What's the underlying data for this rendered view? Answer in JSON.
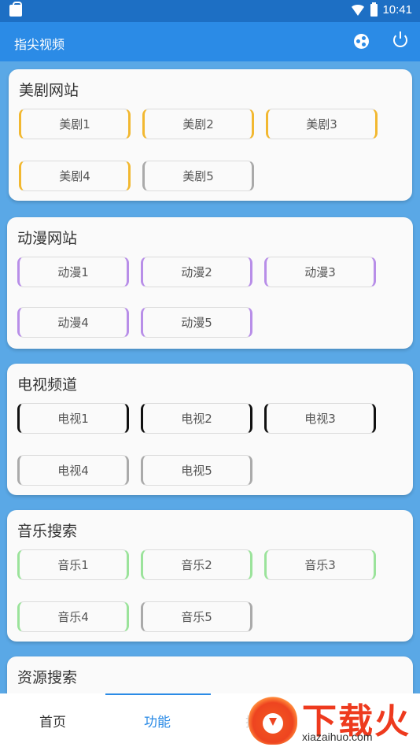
{
  "status_bar": {
    "time": "10:41"
  },
  "app_bar": {
    "title": "指尖视频",
    "share_icon": "share-icon",
    "power_icon": "power-icon"
  },
  "sections": [
    {
      "title": "美剧网站",
      "accent": "#f2b830",
      "buttons": [
        "美剧1",
        "美剧2",
        "美剧3",
        "美剧4",
        "美剧5"
      ]
    },
    {
      "title": "动漫网站",
      "accent": "#b88ee8",
      "buttons": [
        "动漫1",
        "动漫2",
        "动漫3",
        "动漫4",
        "动漫5"
      ]
    },
    {
      "title": "电视频道",
      "accent": "#111111",
      "buttons": [
        "电视1",
        "电视2",
        "电视3",
        "电视4",
        "电视5"
      ]
    },
    {
      "title": "音乐搜索",
      "accent": "#9be39b",
      "buttons": [
        "音乐1",
        "音乐2",
        "音乐3",
        "音乐4",
        "音乐5"
      ]
    },
    {
      "title": "资源搜索"
    }
  ],
  "bottom_nav": {
    "tabs": [
      "首页",
      "功能",
      "搜"
    ],
    "active": "功能"
  },
  "watermark": {
    "text": "下载火",
    "sub": "xiazaihuo.com"
  }
}
